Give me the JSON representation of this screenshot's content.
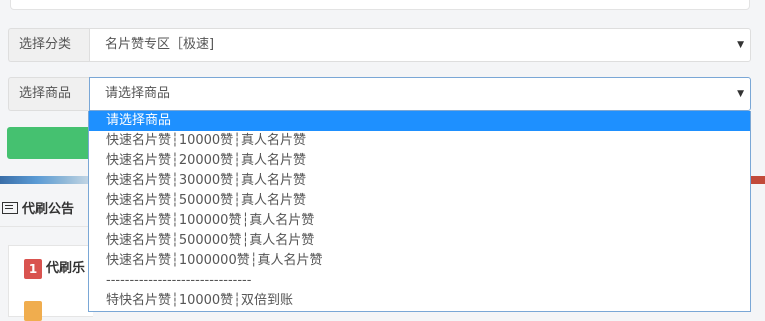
{
  "form": {
    "category_label": "选择分类",
    "category_value": "名片赞专区［极速]",
    "product_label": "选择商品",
    "product_value": "请选择商品",
    "caret": "▼"
  },
  "notice": {
    "title": "代刷公告",
    "first_rank": "1",
    "first_item": "代刷乐"
  },
  "dropdown": {
    "options": [
      "请选择商品",
      "快速名片赞┆10000赞┆真人名片赞",
      "快速名片赞┆20000赞┆真人名片赞",
      "快速名片赞┆30000赞┆真人名片赞",
      "快速名片赞┆50000赞┆真人名片赞",
      "快速名片赞┆100000赞┆真人名片赞",
      "快速名片赞┆500000赞┆真人名片赞",
      "快速名片赞┆1000000赞┆真人名片赞",
      "-------------------------------",
      "特快名片赞┆10000赞┆双倍到账"
    ],
    "selected_index": 0
  },
  "colors": {
    "selected_bg": "#1e90ff",
    "green_button": "#45c170",
    "rank_red": "#d9534f",
    "rank_orange": "#f0ad4e"
  }
}
